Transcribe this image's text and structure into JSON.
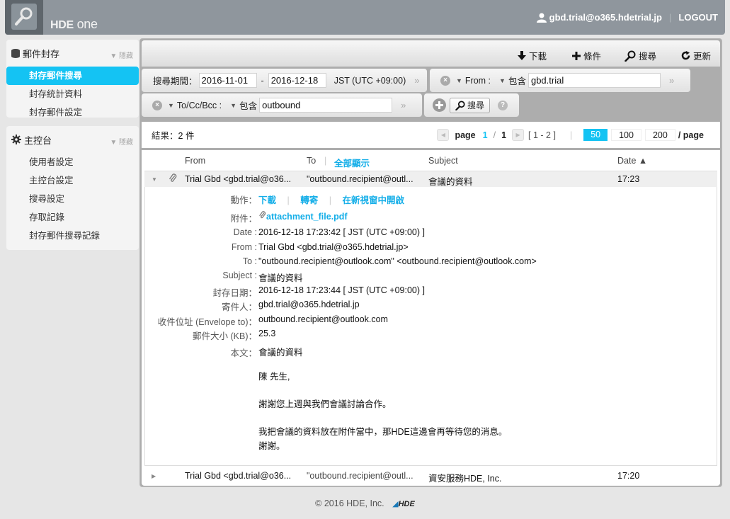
{
  "header": {
    "brand_bold": "HDE",
    "brand_light": " one",
    "user_email": "gbd.trial@o365.hdetrial.jp",
    "logout_label": "LOGOUT"
  },
  "sidebar": {
    "sections": [
      {
        "title": "郵件封存",
        "icon": "database-icon",
        "hide_label": "▼ 隱藏",
        "items": [
          {
            "label": "封存郵件搜尋",
            "active": true
          },
          {
            "label": "封存統計資料",
            "active": false
          },
          {
            "label": "封存郵件設定",
            "active": false
          }
        ]
      },
      {
        "title": "主控台",
        "icon": "gear-icon",
        "hide_label": "▼ 隱藏",
        "items": [
          {
            "label": "使用者設定"
          },
          {
            "label": "主控台設定"
          },
          {
            "label": "搜尋設定"
          },
          {
            "label": "存取記錄"
          },
          {
            "label": "封存郵件搜尋記錄"
          }
        ]
      }
    ]
  },
  "toolbar": {
    "download_label": "下載",
    "condition_label": "條件",
    "search_label": "搜尋",
    "refresh_label": "更新"
  },
  "filters": {
    "period_label": "搜尋期間：",
    "date_from": "2016-11-01",
    "date_sep": "-",
    "date_to": "2016-12-18",
    "timezone": "JST (UTC +09:00)",
    "from_field": "From :",
    "from_op": "包含",
    "from_value": "gbd.trial",
    "to_field": "To/Cc/Bcc :",
    "to_op": "包含",
    "to_value": "outbound",
    "search_button": "搜尋",
    "expand_glyph": "»"
  },
  "results": {
    "count_label": "結果：",
    "count_value": "2 件",
    "page_label": "page",
    "current_page": "1",
    "page_sep": "/",
    "total_pages": "1",
    "range": "[ 1 - 2 ]",
    "per_page_options": [
      "50",
      "100",
      "200"
    ],
    "per_page_selected": "50",
    "per_page_suffix": "/ page"
  },
  "list": {
    "columns": {
      "from": "From",
      "to": "To",
      "show_all": "全部顯示",
      "subject": "Subject",
      "date": "Date ▲"
    },
    "rows": [
      {
        "from": "Trial Gbd <gbd.trial@o36...",
        "to": "\"outbound.recipient@outl...",
        "subject": "會議的資料",
        "date": "17:23",
        "has_attachment": true,
        "expanded": true
      },
      {
        "from": "Trial Gbd <gbd.trial@o36...",
        "to": "\"outbound.recipient@outl...",
        "subject": "資安服務HDE, Inc.",
        "date": "17:20",
        "has_attachment": false,
        "expanded": false
      }
    ],
    "detail": {
      "actions_label": "動作：",
      "actions": [
        "下載",
        "轉寄",
        "在新視窗中開啟"
      ],
      "attachment_label": "附件：",
      "attachment_name": "attachment_file.pdf",
      "date_label": "Date :",
      "date_value": "2016-12-18 17:23:42 [ JST (UTC +09:00) ]",
      "from_label": "From :",
      "from_value": "Trial Gbd <gbd.trial@o365.hdetrial.jp>",
      "to_label": "To :",
      "to_value": "\"outbound.recipient@outlook.com\" <outbound.recipient@outlook.com>",
      "subject_label": "Subject :",
      "subject_value": "會議的資料",
      "archived_label": "封存日期：",
      "archived_value": "2016-12-18 17:23:44 [ JST (UTC +09:00) ]",
      "sender_label": "寄件人：",
      "sender_value": "gbd.trial@o365.hdetrial.jp",
      "envelope_label": "收件位址 (Envelope to)：",
      "envelope_value": "outbound.recipient@outlook.com",
      "size_label": "郵件大小 (KB)：",
      "size_value": "25.3",
      "body_label": "本文：",
      "body_lines": [
        "會議的資料",
        "",
        "陳 先生,",
        "",
        "謝謝您上週與我們會議討論合作。",
        "",
        "我把會議的資料放在附件當中，那HDE這邊會再等待您的消息。",
        "謝謝。"
      ]
    }
  },
  "footer": {
    "copyright": "© 2016 HDE, Inc.",
    "logo_text": "HDE"
  },
  "colors": {
    "accent": "#14c3f3",
    "link": "#14aee8",
    "header_bg": "#8f969d"
  }
}
